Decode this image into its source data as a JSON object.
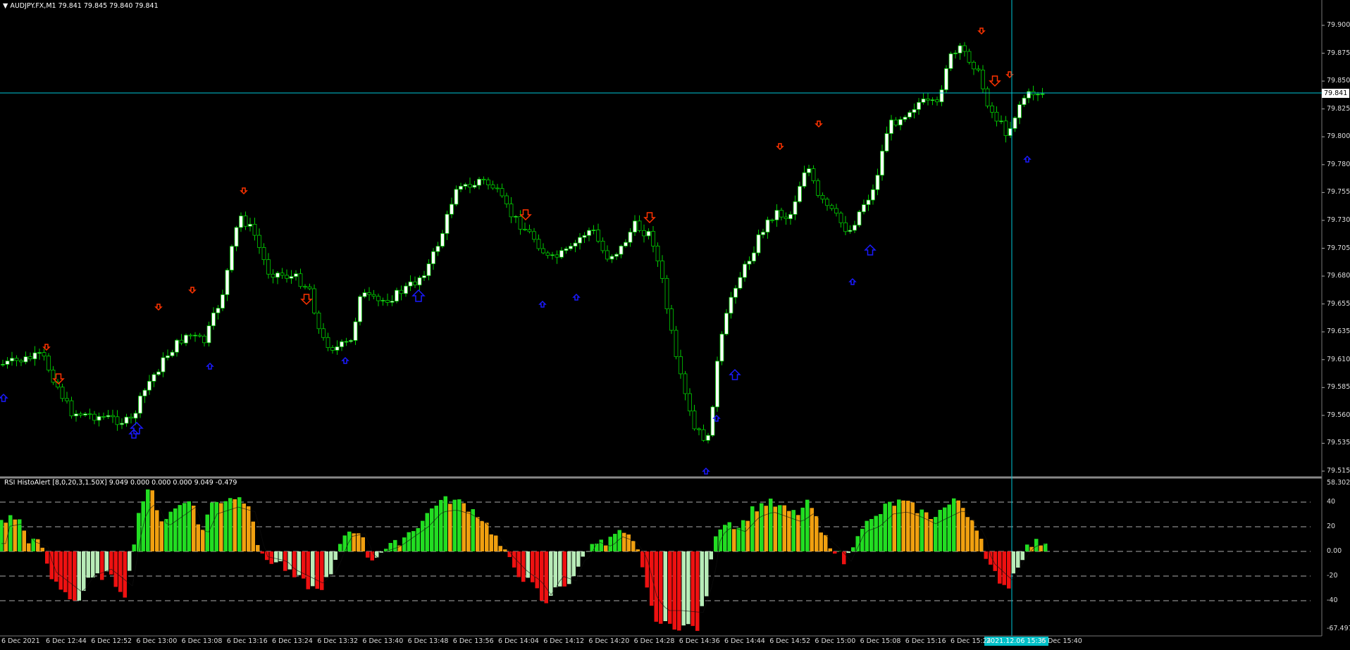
{
  "main_chart": {
    "title": "AUDJPY.FX,M1",
    "ohlc": "79.841 79.845 79.840 79.841",
    "current_price": "79.841",
    "y_ticks": [
      "79.900",
      "79.875",
      "79.850",
      "79.825",
      "79.800",
      "79.780",
      "79.755",
      "79.730",
      "79.705",
      "79.680",
      "79.655",
      "79.635",
      "79.610",
      "79.585",
      "79.560",
      "79.535",
      "79.515"
    ]
  },
  "indicator": {
    "title": "RSI HistoAlert [8,0,20,3,1.50X] 9.049 0.000 0.000 0.000 9.049 -0.479",
    "y_ticks": [
      "58.302",
      "40",
      "20",
      "0.00",
      "-20",
      "-40",
      "-67.497"
    ]
  },
  "x_axis": {
    "labels": [
      "6 Dec 2021",
      "6 Dec 12:44",
      "6 Dec 12:52",
      "6 Dec 13:00",
      "6 Dec 13:08",
      "6 Dec 13:16",
      "6 Dec 13:24",
      "6 Dec 13:32",
      "6 Dec 13:40",
      "6 Dec 13:48",
      "6 Dec 13:56",
      "6 Dec 14:04",
      "6 Dec 14:12",
      "6 Dec 14:20",
      "6 Dec 14:28",
      "6 Dec 14:36",
      "6 Dec 14:44",
      "6 Dec 14:52",
      "6 Dec 15:00",
      "6 Dec 15:08",
      "6 Dec 15:16",
      "6 Dec 15:24",
      "6 Dec 15:40"
    ],
    "cursor_time": "2021.12.06 15:35"
  },
  "colors": {
    "background": "#000000",
    "bull_body": "#ffffff",
    "bear_body": "#000000",
    "candle_outline": "#00cc00",
    "rsi_up_strong": "#22dd22",
    "rsi_up_weak": "#f0a010",
    "rsi_down_strong": "#ee1111",
    "rsi_down_weak": "#b8ecb8",
    "up_arrow": "#1a1aff",
    "down_arrow": "#ff3300",
    "crosshair": "#00c8d8"
  }
}
